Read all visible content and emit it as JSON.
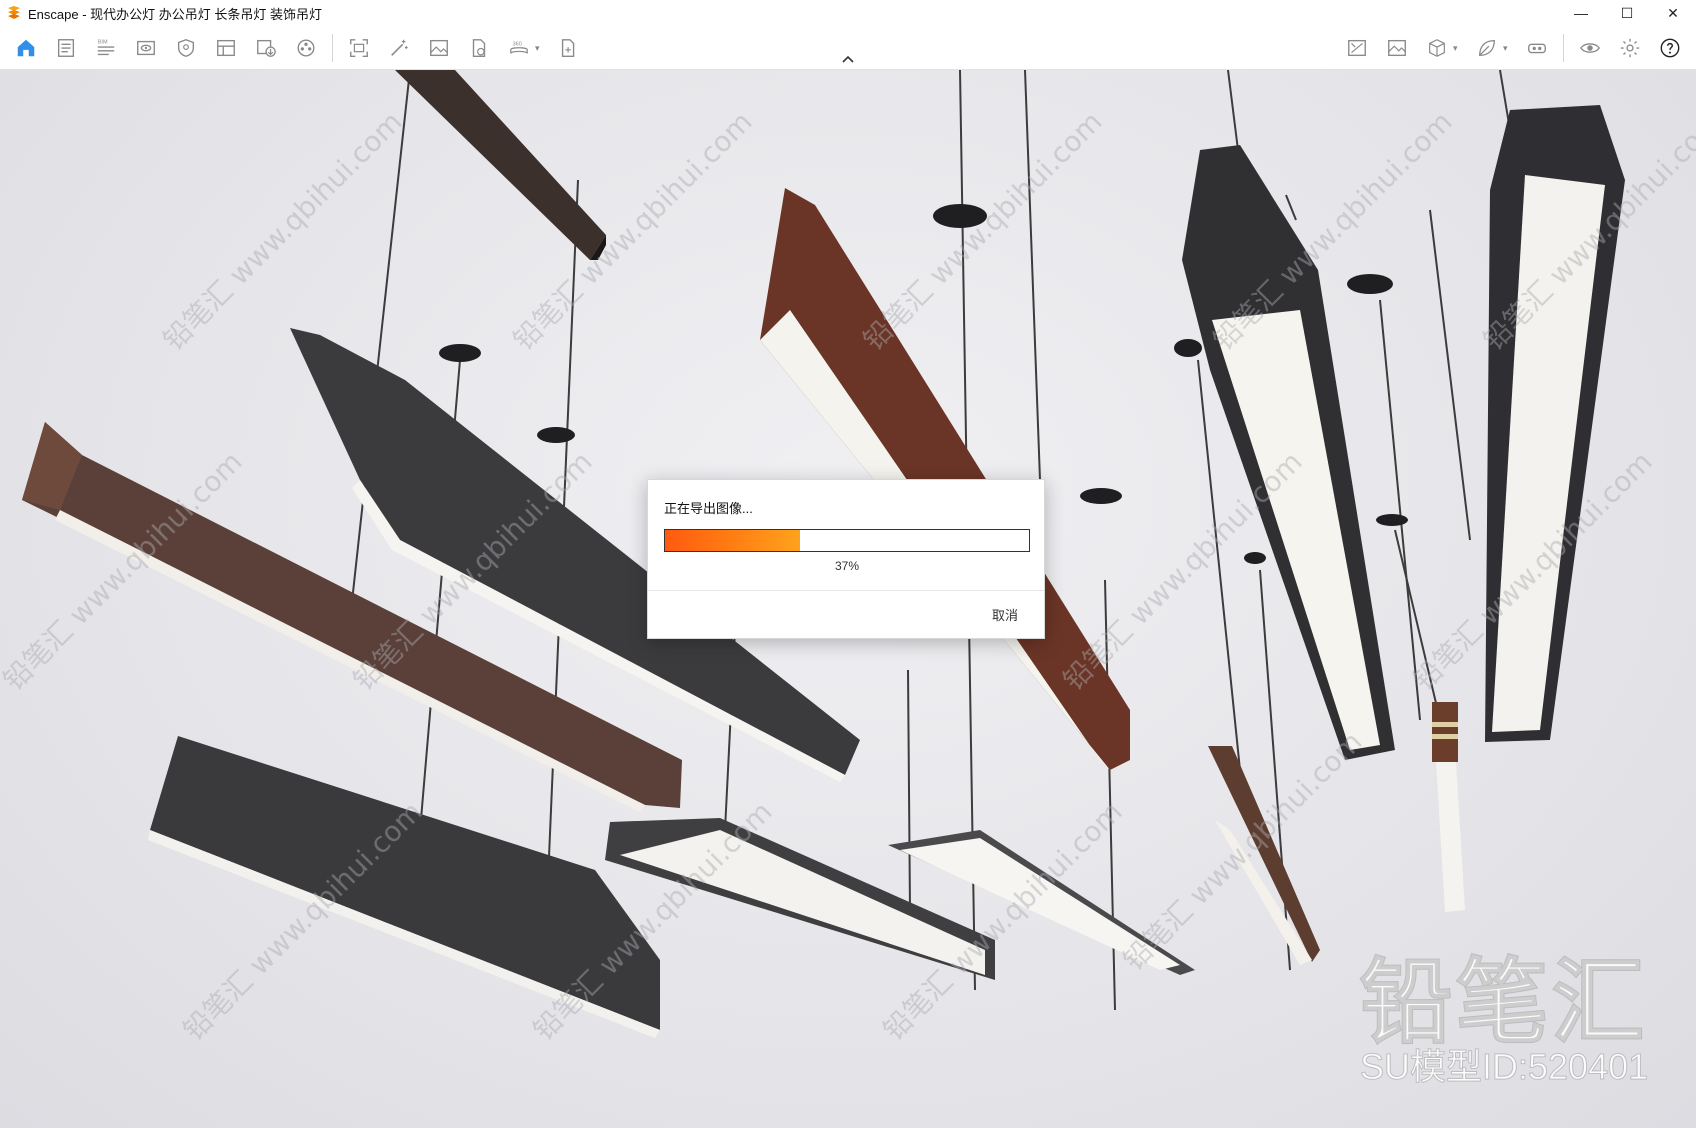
{
  "window": {
    "title": "Enscape - 现代办公灯 办公吊灯 长条吊灯 装饰吊灯",
    "controls": {
      "minimize": "—",
      "maximize": "☐",
      "close": "✕"
    }
  },
  "toolbar": {
    "left_icons": [
      "home-icon",
      "document-icon",
      "bim-icon",
      "monitor-view-icon",
      "shield-icon",
      "batch-render-icon",
      "export-icon",
      "film-reel-icon",
      "screenshot-icon",
      "magic-wand-icon",
      "image-icon",
      "file-export-icon",
      "panorama-360-icon",
      "web-export-icon"
    ],
    "right_icons": [
      "asset-library-icon",
      "image-settings-icon",
      "cube-icon",
      "leaf-icon",
      "vr-headset-icon",
      "eye-icon",
      "settings-gear-icon",
      "help-icon"
    ],
    "bim_label": "BIM",
    "pano_label": "360",
    "accent": "#2f8fea"
  },
  "dialog": {
    "title": "正在导出图像...",
    "progress_percent": 37,
    "progress_label": "37%",
    "cancel_label": "取消"
  },
  "watermark": {
    "brand": "铅笔汇",
    "model_id": "SU模型ID:520401",
    "tile_text": "铅笔汇 www.qbihui.com"
  }
}
